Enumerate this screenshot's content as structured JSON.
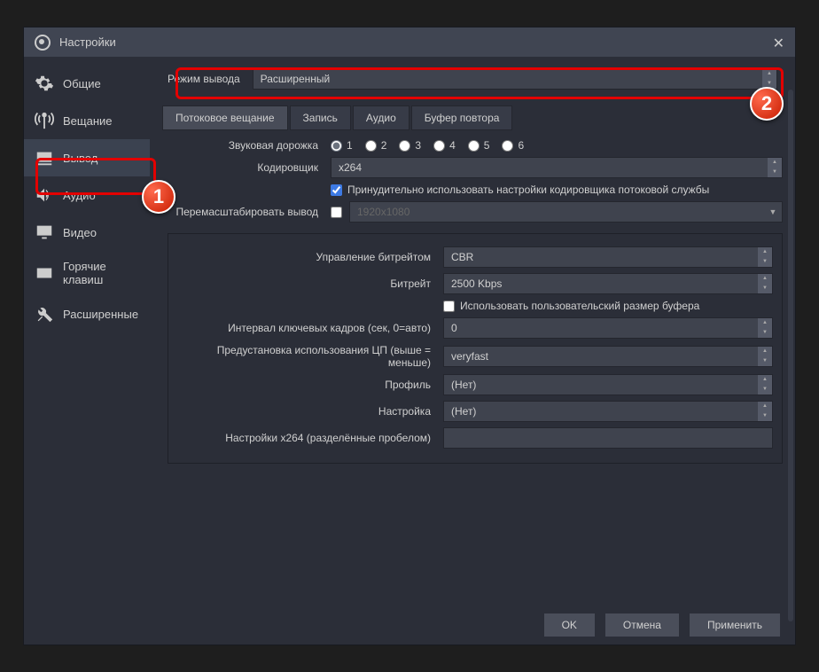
{
  "window": {
    "title": "Настройки"
  },
  "sidebar": {
    "items": [
      {
        "label": "Общие"
      },
      {
        "label": "Вещание"
      },
      {
        "label": "Вывод"
      },
      {
        "label": "Аудио"
      },
      {
        "label": "Видео"
      },
      {
        "label": "Горячие клавиш"
      },
      {
        "label": "Расширенные"
      }
    ]
  },
  "mode": {
    "label": "Режим вывода",
    "value": "Расширенный"
  },
  "tabs": [
    {
      "label": "Потоковое вещание"
    },
    {
      "label": "Запись"
    },
    {
      "label": "Аудио"
    },
    {
      "label": "Буфер повтора"
    }
  ],
  "fields": {
    "track_label": "Звуковая дорожка",
    "tracks": [
      "1",
      "2",
      "3",
      "4",
      "5",
      "6"
    ],
    "encoder_label": "Кодировщик",
    "encoder_value": "x264",
    "enforce_label": "Принудительно использовать настройки кодировщика потоковой службы",
    "rescale_label": "Перемасштабировать вывод",
    "rescale_value": "1920x1080",
    "ratectl_label": "Управление битрейтом",
    "ratectl_value": "CBR",
    "bitrate_label": "Битрейт",
    "bitrate_value": "2500 Kbps",
    "custbuf_label": "Использовать пользовательский размер буфера",
    "keyint_label": "Интервал ключевых кадров (сек, 0=авто)",
    "keyint_value": "0",
    "cpu_label": "Предустановка использования ЦП (выше = меньше)",
    "cpu_value": "veryfast",
    "profile_label": "Профиль",
    "profile_value": "(Нет)",
    "tune_label": "Настройка",
    "tune_value": "(Нет)",
    "x264_label": "Настройки x264 (разделённые пробелом)"
  },
  "buttons": {
    "ok": "OK",
    "cancel": "Отмена",
    "apply": "Применить"
  },
  "badges": {
    "one": "1",
    "two": "2"
  }
}
